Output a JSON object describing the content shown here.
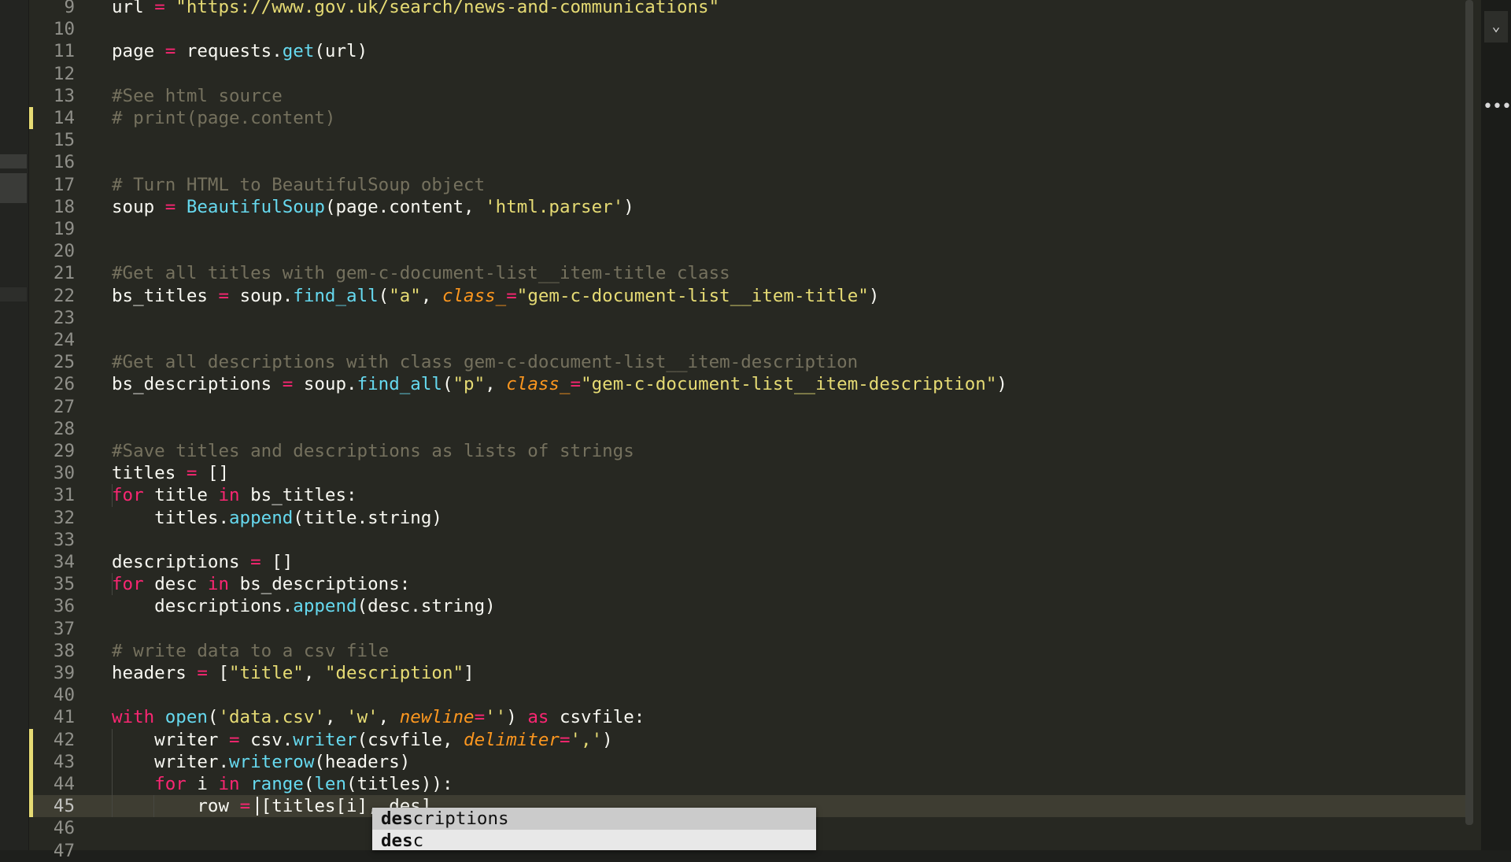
{
  "editor": {
    "language": "python",
    "current_line": "45",
    "lines": [
      {
        "n": "9",
        "tokens": [
          [
            "",
            "url "
          ],
          [
            "op",
            "= "
          ],
          [
            "str",
            "\"https://www.gov.uk/search/news-and-communications\""
          ]
        ]
      },
      {
        "n": "10",
        "tokens": []
      },
      {
        "n": "11",
        "tokens": [
          [
            "",
            "page "
          ],
          [
            "op",
            "= "
          ],
          [
            "",
            "requests."
          ],
          [
            "fn",
            "get"
          ],
          [
            "",
            "(url)"
          ]
        ]
      },
      {
        "n": "12",
        "tokens": []
      },
      {
        "n": "13",
        "tokens": [
          [
            "cm",
            "#See html source"
          ]
        ]
      },
      {
        "n": "14",
        "tokens": [
          [
            "cm",
            "# print(page.content)"
          ]
        ]
      },
      {
        "n": "15",
        "tokens": []
      },
      {
        "n": "16",
        "tokens": []
      },
      {
        "n": "17",
        "tokens": [
          [
            "cm",
            "# Turn HTML to BeautifulSoup object"
          ]
        ]
      },
      {
        "n": "18",
        "tokens": [
          [
            "",
            "soup "
          ],
          [
            "op",
            "= "
          ],
          [
            "fn",
            "BeautifulSoup"
          ],
          [
            "",
            "(page.content, "
          ],
          [
            "str",
            "'html.parser'"
          ],
          [
            "",
            ")"
          ]
        ]
      },
      {
        "n": "19",
        "tokens": []
      },
      {
        "n": "20",
        "tokens": []
      },
      {
        "n": "21",
        "tokens": [
          [
            "cm",
            "#Get all titles with gem-c-document-list__item-title class"
          ]
        ]
      },
      {
        "n": "22",
        "tokens": [
          [
            "",
            "bs_titles "
          ],
          [
            "op",
            "= "
          ],
          [
            "",
            "soup."
          ],
          [
            "fn",
            "find_all"
          ],
          [
            "",
            "("
          ],
          [
            "str",
            "\"a\""
          ],
          [
            "",
            ", "
          ],
          [
            "par",
            "class_"
          ],
          [
            "op",
            "="
          ],
          [
            "str",
            "\"gem-c-document-list__item-title\""
          ],
          [
            "",
            ")"
          ]
        ]
      },
      {
        "n": "23",
        "tokens": []
      },
      {
        "n": "24",
        "tokens": []
      },
      {
        "n": "25",
        "tokens": [
          [
            "cm",
            "#Get all descriptions with class gem-c-document-list__item-description"
          ]
        ]
      },
      {
        "n": "26",
        "tokens": [
          [
            "",
            "bs_descriptions "
          ],
          [
            "op",
            "= "
          ],
          [
            "",
            "soup."
          ],
          [
            "fn",
            "find_all"
          ],
          [
            "",
            "("
          ],
          [
            "str",
            "\"p\""
          ],
          [
            "",
            ", "
          ],
          [
            "par",
            "class_"
          ],
          [
            "op",
            "="
          ],
          [
            "str",
            "\"gem-c-document-list__item-description\""
          ],
          [
            "",
            ")"
          ]
        ]
      },
      {
        "n": "27",
        "tokens": []
      },
      {
        "n": "28",
        "tokens": []
      },
      {
        "n": "29",
        "tokens": [
          [
            "cm",
            "#Save titles and descriptions as lists of strings"
          ]
        ]
      },
      {
        "n": "30",
        "tokens": [
          [
            "",
            "titles "
          ],
          [
            "op",
            "= "
          ],
          [
            "",
            "[]"
          ]
        ]
      },
      {
        "n": "31",
        "tokens": [
          [
            "kw",
            "for "
          ],
          [
            "",
            "title "
          ],
          [
            "kw",
            "in "
          ],
          [
            "",
            "bs_titles:"
          ]
        ]
      },
      {
        "n": "32",
        "tokens": [
          [
            "",
            "    titles."
          ],
          [
            "fn",
            "append"
          ],
          [
            "",
            "(title.string)"
          ]
        ]
      },
      {
        "n": "33",
        "tokens": []
      },
      {
        "n": "34",
        "tokens": [
          [
            "",
            "descriptions "
          ],
          [
            "op",
            "= "
          ],
          [
            "",
            "[]"
          ]
        ]
      },
      {
        "n": "35",
        "tokens": [
          [
            "kw",
            "for "
          ],
          [
            "",
            "desc "
          ],
          [
            "kw",
            "in "
          ],
          [
            "",
            "bs_descriptions:"
          ]
        ]
      },
      {
        "n": "36",
        "tokens": [
          [
            "",
            "    descriptions."
          ],
          [
            "fn",
            "append"
          ],
          [
            "",
            "(desc.string)"
          ]
        ]
      },
      {
        "n": "37",
        "tokens": []
      },
      {
        "n": "38",
        "tokens": [
          [
            "cm",
            "# write data to a csv file"
          ]
        ]
      },
      {
        "n": "39",
        "tokens": [
          [
            "",
            "headers "
          ],
          [
            "op",
            "= "
          ],
          [
            "",
            "["
          ],
          [
            "str",
            "\"title\""
          ],
          [
            "",
            ", "
          ],
          [
            "str",
            "\"description\""
          ],
          [
            "",
            "]"
          ]
        ]
      },
      {
        "n": "40",
        "tokens": []
      },
      {
        "n": "41",
        "tokens": [
          [
            "kw",
            "with "
          ],
          [
            "fn",
            "open"
          ],
          [
            "",
            "("
          ],
          [
            "str",
            "'data.csv'"
          ],
          [
            "",
            ", "
          ],
          [
            "str",
            "'w'"
          ],
          [
            "",
            ", "
          ],
          [
            "par",
            "newline"
          ],
          [
            "op",
            "="
          ],
          [
            "str",
            "''"
          ],
          [
            "",
            ") "
          ],
          [
            "kw",
            "as "
          ],
          [
            "",
            "csvfile:"
          ]
        ]
      },
      {
        "n": "42",
        "tokens": [
          [
            "",
            "    writer "
          ],
          [
            "op",
            "= "
          ],
          [
            "",
            "csv."
          ],
          [
            "fn",
            "writer"
          ],
          [
            "",
            "(csvfile, "
          ],
          [
            "par",
            "delimiter"
          ],
          [
            "op",
            "="
          ],
          [
            "str",
            "','"
          ],
          [
            "",
            ")"
          ]
        ]
      },
      {
        "n": "43",
        "tokens": [
          [
            "",
            "    writer."
          ],
          [
            "fn",
            "writerow"
          ],
          [
            "",
            "(headers)"
          ]
        ]
      },
      {
        "n": "44",
        "tokens": [
          [
            "",
            "    "
          ],
          [
            "kw",
            "for "
          ],
          [
            "",
            "i "
          ],
          [
            "kw",
            "in "
          ],
          [
            "fn",
            "range"
          ],
          [
            "",
            "("
          ],
          [
            "fn",
            "len"
          ],
          [
            "",
            "(titles)):"
          ]
        ]
      },
      {
        "n": "45",
        "tokens": [
          [
            "",
            "        row "
          ],
          [
            "op",
            "= "
          ],
          [
            "",
            "[titles[i], des]"
          ]
        ]
      },
      {
        "n": "46",
        "tokens": []
      },
      {
        "n": "47",
        "tokens": []
      }
    ]
  },
  "autocomplete": {
    "typed": "des",
    "items": [
      {
        "label": "descriptions",
        "selected": true
      },
      {
        "label": "desc",
        "selected": false
      }
    ]
  },
  "colors": {
    "background": "#272822",
    "keyword": "#f92672",
    "function": "#66d9ef",
    "string": "#e6db74",
    "comment": "#75715e",
    "parameter": "#fd971f"
  },
  "right_panel": {
    "chevron_icon": "chevron-down-icon",
    "chevron_glyph": "⌄",
    "more_icon": "ellipsis-icon",
    "more_glyph": "•••"
  }
}
